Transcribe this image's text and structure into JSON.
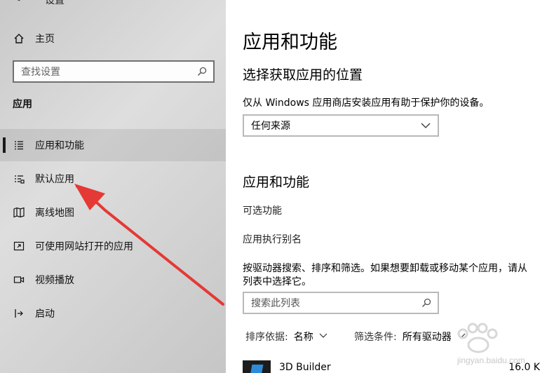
{
  "window": {
    "title": "设置",
    "back_glyph": "<"
  },
  "sidebar": {
    "home_label": "主页",
    "search_placeholder": "查找设置",
    "section_heading": "应用",
    "items": [
      {
        "label": "应用和功能"
      },
      {
        "label": "默认应用"
      },
      {
        "label": "离线地图"
      },
      {
        "label": "可使用网站打开的应用"
      },
      {
        "label": "视频播放"
      },
      {
        "label": "启动"
      }
    ]
  },
  "main": {
    "title": "应用和功能",
    "install_location": {
      "heading": "选择获取应用的位置",
      "description": "仅从 Windows 应用商店安装应用有助于保护你的设备。",
      "dropdown_value": "任何来源"
    },
    "apps_section": {
      "heading": "应用和功能",
      "optional_features_link": "可选功能",
      "aliases_link": "应用执行别名",
      "description_line1": "按驱动器搜索、排序和筛选。如果想要卸载或移动某个应用，请从",
      "description_line2": "列表中选择它。",
      "search_placeholder": "搜索此列表",
      "sort_label": "排序依据:",
      "sort_value": "名称",
      "filter_label": "筛选条件:",
      "filter_value": "所有驱动器",
      "apps": [
        {
          "name": "3D Builder",
          "size": "16.0 K"
        }
      ]
    }
  },
  "watermark_text": "jingyan.baidu.com",
  "colors": {
    "sidebar_bg": "#d4d4d4",
    "arrow": "#e53935",
    "app_icon_accent": "#2e8bd8"
  }
}
